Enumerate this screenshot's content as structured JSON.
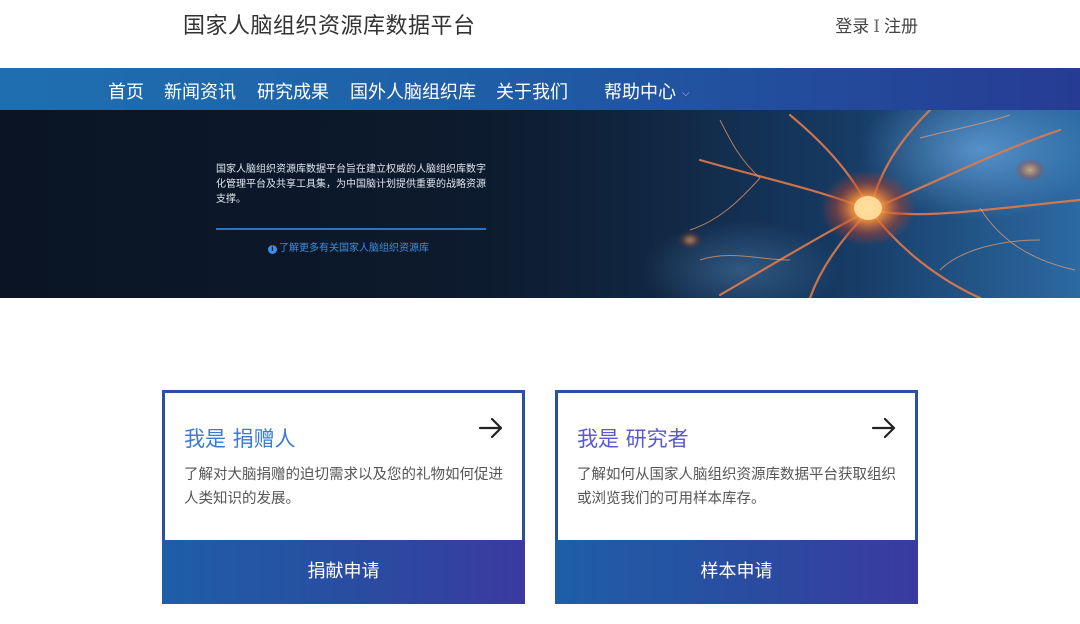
{
  "header": {
    "site_title": "国家人脑组织资源库数据平台",
    "login": "登录",
    "separator": "I",
    "register": "注册"
  },
  "nav": {
    "items": [
      {
        "label": "首页"
      },
      {
        "label": "新闻资讯"
      },
      {
        "label": "研究成果"
      },
      {
        "label": "国外人脑组织库"
      },
      {
        "label": "关于我们"
      },
      {
        "label": "帮助中心"
      }
    ]
  },
  "banner": {
    "description": "国家人脑组织资源库数据平台旨在建立权威的人脑组织库数字化管理平台及共享工具集，为中国脑计划提供重要的战略资源支撑。",
    "link_text": "了解更多有关国家人脑组织资源库",
    "info_glyph": "i"
  },
  "cards": [
    {
      "title": "我是 捐赠人",
      "description": "了解对大脑捐赠的迫切需求以及您的礼物如何促进人类知识的发展。",
      "button": "捐献申请"
    },
    {
      "title": "我是 研究者",
      "description": "了解如何从国家人脑组织资源库数据平台获取组织或浏览我们的可用样本库存。",
      "button": "样本申请"
    }
  ],
  "colors": {
    "nav_start": "#1f6fb0",
    "nav_end": "#263c94",
    "donor_title": "#3a7bd5",
    "researcher_title": "#5a5ad0",
    "card_border": "#2a50a0"
  },
  "icons": {
    "arrow": "arrow-right-icon",
    "info": "info-icon",
    "dropdown": "chevron-down-icon"
  }
}
